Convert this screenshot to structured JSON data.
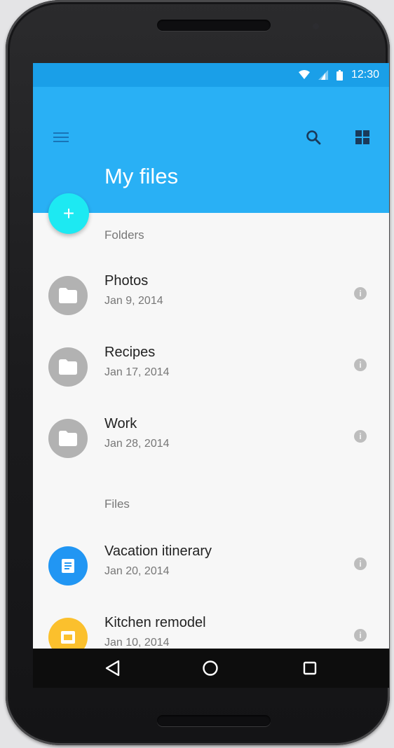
{
  "status": {
    "time": "12:30"
  },
  "appbar": {
    "title": "My files"
  },
  "fab": {
    "label": "+"
  },
  "folders_header": "Folders",
  "files_header": "Files",
  "folders": [
    {
      "name": "Photos",
      "date": "Jan 9, 2014"
    },
    {
      "name": "Recipes",
      "date": "Jan 17, 2014"
    },
    {
      "name": "Work",
      "date": "Jan 28, 2014"
    }
  ],
  "files": [
    {
      "name": "Vacation itinerary",
      "date": "Jan 20, 2014"
    },
    {
      "name": "Kitchen remodel",
      "date": "Jan 10, 2014"
    }
  ],
  "info_label": "i",
  "colors": {
    "appbar": "#29b0f5",
    "statusbar": "#1a9fe8",
    "fab": "#1de9f2",
    "folder_avatar": "#b2b2b2",
    "doc_avatar": "#2196f3",
    "slides_avatar": "#fbc02d"
  }
}
